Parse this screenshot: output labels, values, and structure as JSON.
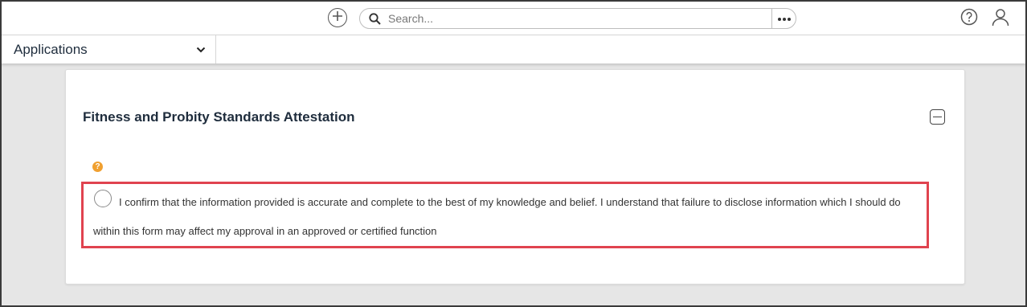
{
  "topbar": {
    "add_icon": "plus-circle-icon",
    "search": {
      "placeholder": "Search...",
      "value": ""
    },
    "more_icon": "ellipsis-icon",
    "help_icon": "question-circle-icon",
    "user_icon": "user-icon"
  },
  "nav": {
    "app_label": "Applications",
    "chevron_icon": "chevron-down-icon"
  },
  "section": {
    "title": "Fitness and Probity Standards Attestation",
    "collapse_icon": "minus-square-icon",
    "help_badge": "?",
    "attestation_text": "I confirm that the information provided is accurate and complete to the best of my knowledge and belief. I understand that failure to disclose information which I should do within this form may affect my approval in an approved or certified function",
    "highlight_color": "#e0434f",
    "help_color": "#f0a030"
  }
}
